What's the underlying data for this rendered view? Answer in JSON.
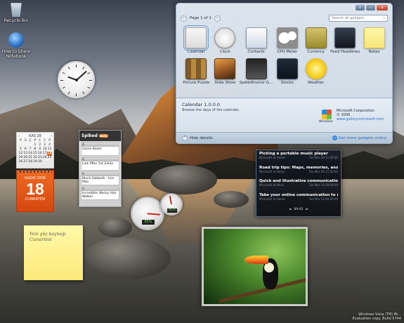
{
  "desktop_icons": [
    {
      "label": "Recycle Bin",
      "icon": "recycle-bin-icon"
    },
    {
      "label": "How to Share Notebook",
      "icon": "help-icon"
    }
  ],
  "calendar": {
    "month_header": "KAS 28",
    "weekdays": [
      "P",
      "S",
      "Ç",
      "P",
      "C",
      "C",
      "P"
    ],
    "days": [
      "",
      "",
      "",
      "1",
      "2",
      "3",
      "4",
      "5",
      "6",
      "7",
      "8",
      "9",
      "10",
      "11",
      "12",
      "13",
      "14",
      "15",
      "16",
      "17",
      "18",
      "19",
      "20",
      "21",
      "22",
      "23",
      "24",
      "25",
      "26",
      "27",
      "28",
      "29",
      "30",
      "",
      ""
    ],
    "today_index": 20,
    "month_label": "KASIM 2006",
    "day": "18",
    "weekday_label": "CUMARTESİ"
  },
  "spiked": {
    "title": "Spiked",
    "badge": "daily",
    "items": [
      {
        "title": "Game Boxer",
        "rating": "A"
      },
      {
        "title": "Link After 1st Zelda",
        "rating": "A"
      },
      {
        "title": "Black Sabbath - Iron Man",
        "rating": "A"
      },
      {
        "title": "Incredible Wacky Hair Walker",
        "rating": "A"
      }
    ]
  },
  "cpu_meter": {
    "cpu": "85%",
    "memory": "46%",
    "cpu_level": 0.85,
    "memory_level": 0.46
  },
  "note": {
    "text": "Yeni güç kaynağı Cumartesi"
  },
  "feeds": {
    "items": [
      {
        "title": "Picking a portable music player",
        "source": "Microsoft at Home",
        "time": "Tue Mar 28 11:00:00"
      },
      {
        "title": "Road trip tips: Maps, memories, and more",
        "source": "Microsoft at Home",
        "time": "Tue Mar 28 11:00:00"
      },
      {
        "title": "Quick and illustrative communication wi...",
        "source": "Microsoft at Work",
        "time": "Tue Mar 14 00:00:00"
      },
      {
        "title": "Take your online communication to new...",
        "source": "Microsoft at Home",
        "time": "Tue Mar 14 00:00:00"
      }
    ],
    "pager": "89-92"
  },
  "gallery": {
    "page_label": "Page 1 of 1",
    "search_placeholder": "Search all gadgets",
    "window_buttons": [
      "+",
      "–",
      "x"
    ],
    "gadgets": [
      {
        "name": "Calendar",
        "thumb": "t-calendar",
        "icon": "calendar-icon"
      },
      {
        "name": "Clock",
        "thumb": "t-clock",
        "icon": "clock-icon"
      },
      {
        "name": "Contacts",
        "thumb": "t-contacts",
        "icon": "contacts-icon"
      },
      {
        "name": "CPU Meter",
        "thumb": "t-cpu",
        "icon": "cpu-meter-icon"
      },
      {
        "name": "Currency",
        "thumb": "t-currency",
        "icon": "currency-icon"
      },
      {
        "name": "Feed Headlines",
        "thumb": "t-feed",
        "icon": "feed-headlines-icon"
      },
      {
        "name": "Notes",
        "thumb": "t-notes",
        "icon": "notes-icon"
      },
      {
        "name": "Picture Puzzle",
        "thumb": "t-puzzle",
        "icon": "picture-puzzle-icon"
      },
      {
        "name": "Slide Show",
        "thumb": "t-slide",
        "icon": "slide-show-icon"
      },
      {
        "name": "Spikedhumor G...",
        "thumb": "t-spiked",
        "icon": "spiked-icon"
      },
      {
        "name": "Stocks",
        "thumb": "t-stocks",
        "icon": "stocks-icon"
      },
      {
        "name": "Weather",
        "thumb": "t-weather",
        "icon": "weather-icon"
      }
    ],
    "selected_index": 0,
    "detail": {
      "title": "Calendar 1.0.0.0",
      "description": "Browse the days of the calendar.",
      "publisher": "Microsoft Corporation",
      "copyright": "© 2006",
      "url": "www.gallery.microsoft.com",
      "windows_label": "Windows"
    },
    "hide_details": "Hide details",
    "get_more": "Get more gadgets online"
  },
  "watermark": {
    "line1": "Windows Vista (TM) Bt...",
    "line2": "Evaluation copy. Build 5744"
  }
}
